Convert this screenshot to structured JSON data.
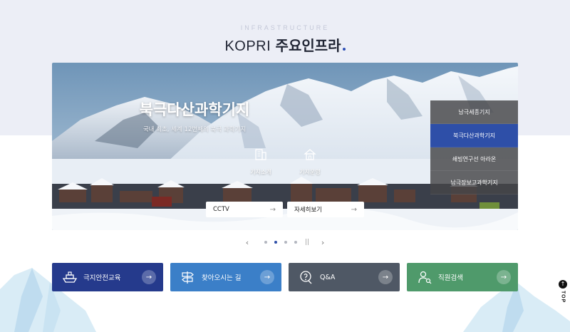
{
  "header": {
    "eyebrow": "INFRASTRUCTURE",
    "title_latin": "KOPRI",
    "title_korean": "주요인프라"
  },
  "hero": {
    "title": "북극다산과학기지",
    "subtitle": "국내 최초, 세계 12번째의 북극 과학기지",
    "icon_links": [
      {
        "label": "기지소개",
        "icon": "building-icon"
      },
      {
        "label": "기지운영",
        "icon": "house-icon"
      }
    ],
    "buttons": [
      {
        "label": "CCTV",
        "arrow": "→"
      },
      {
        "label": "자세히보기",
        "arrow": "→"
      }
    ],
    "side_menu": [
      {
        "label": "남극세종기지",
        "active": false
      },
      {
        "label": "북극다산과학기지",
        "active": true
      },
      {
        "label": "쇄빙연구선 아라온",
        "active": false
      },
      {
        "label": "남극장보고과학기지",
        "active": false
      }
    ]
  },
  "pager": {
    "prev": "‹",
    "next": "›",
    "pause": "||",
    "dots": 4,
    "active_index": 1
  },
  "quick_links": [
    {
      "label": "극지안전교육",
      "icon": "boat-icon",
      "color": "#253a8c",
      "arrow": "→"
    },
    {
      "label": "찾아오시는 길",
      "icon": "signpost-icon",
      "color": "#3b7fc8",
      "arrow": "→"
    },
    {
      "label": "Q&A",
      "icon": "question-bubble-icon",
      "color": "#4f5865",
      "arrow": "→"
    },
    {
      "label": "직원검색",
      "icon": "person-search-icon",
      "color": "#4f9a6b",
      "arrow": "→"
    }
  ],
  "top_button": {
    "label": "TOP",
    "arrow": "↑"
  },
  "colors": {
    "accent": "#2e4fa8",
    "band": "#eceef6"
  }
}
